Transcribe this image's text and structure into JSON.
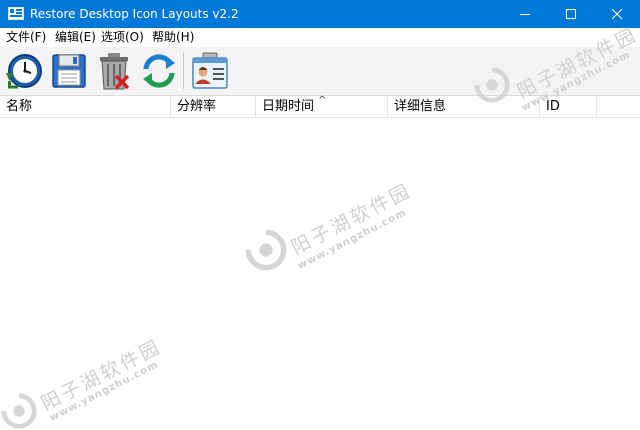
{
  "window": {
    "title": "Restore Desktop Icon Layouts v2.2"
  },
  "menu": [
    {
      "label": "文件(F)"
    },
    {
      "label": "编辑(E)"
    },
    {
      "label": "选项(O)"
    },
    {
      "label": "帮助(H)"
    }
  ],
  "toolbar": [
    {
      "icon": "clock-icon"
    },
    {
      "icon": "floppy-disk-icon"
    },
    {
      "icon": "trash-delete-icon"
    },
    {
      "icon": "refresh-icon"
    },
    {
      "icon": "id-card-icon"
    }
  ],
  "columns": [
    {
      "label": "名称"
    },
    {
      "label": "分辨率"
    },
    {
      "label": "日期时间"
    },
    {
      "label": "详细信息"
    },
    {
      "label": "ID"
    }
  ],
  "sort_indicator": "^",
  "watermark": {
    "text": "阳子湖软件园",
    "url": "www.yangzhu.com"
  },
  "colors": {
    "titlebar": "#0078d7",
    "watermark": "#cfcfcf"
  }
}
